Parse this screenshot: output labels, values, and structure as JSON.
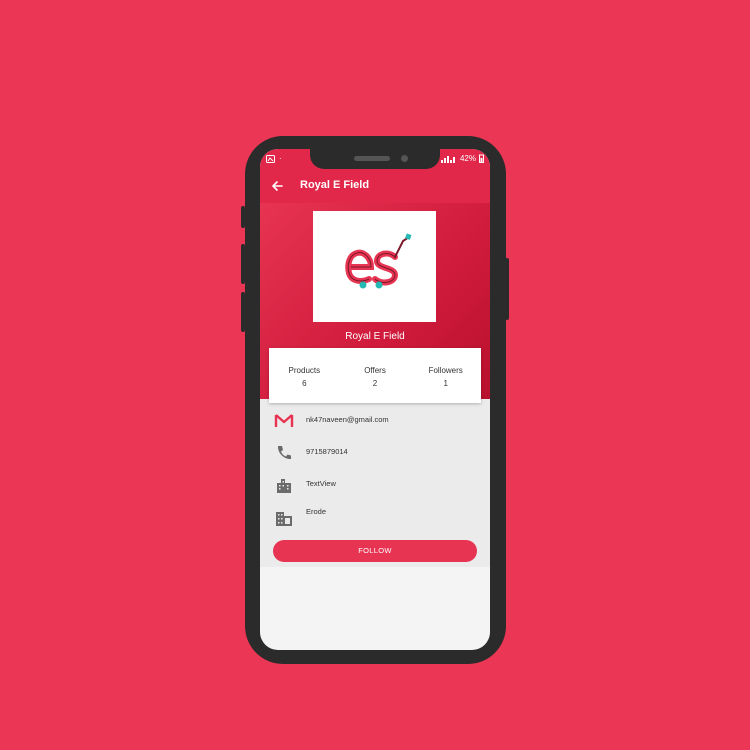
{
  "status_bar": {
    "battery": "42%"
  },
  "app_bar": {
    "title": "Royal E Field",
    "back_icon": "arrow-back-icon"
  },
  "store": {
    "name": "Royal E Field",
    "logo_text": "es"
  },
  "stats": [
    {
      "label": "Products",
      "value": "6"
    },
    {
      "label": "Offers",
      "value": "2"
    },
    {
      "label": "Followers",
      "value": "1"
    }
  ],
  "info": {
    "email": "nk47naveen@gmail.com",
    "phone": "9715879014",
    "address": "TextView",
    "city": "Erode"
  },
  "follow_label": "FOLLOW",
  "colors": {
    "brand": "#e73452",
    "background": "#ec3655"
  }
}
